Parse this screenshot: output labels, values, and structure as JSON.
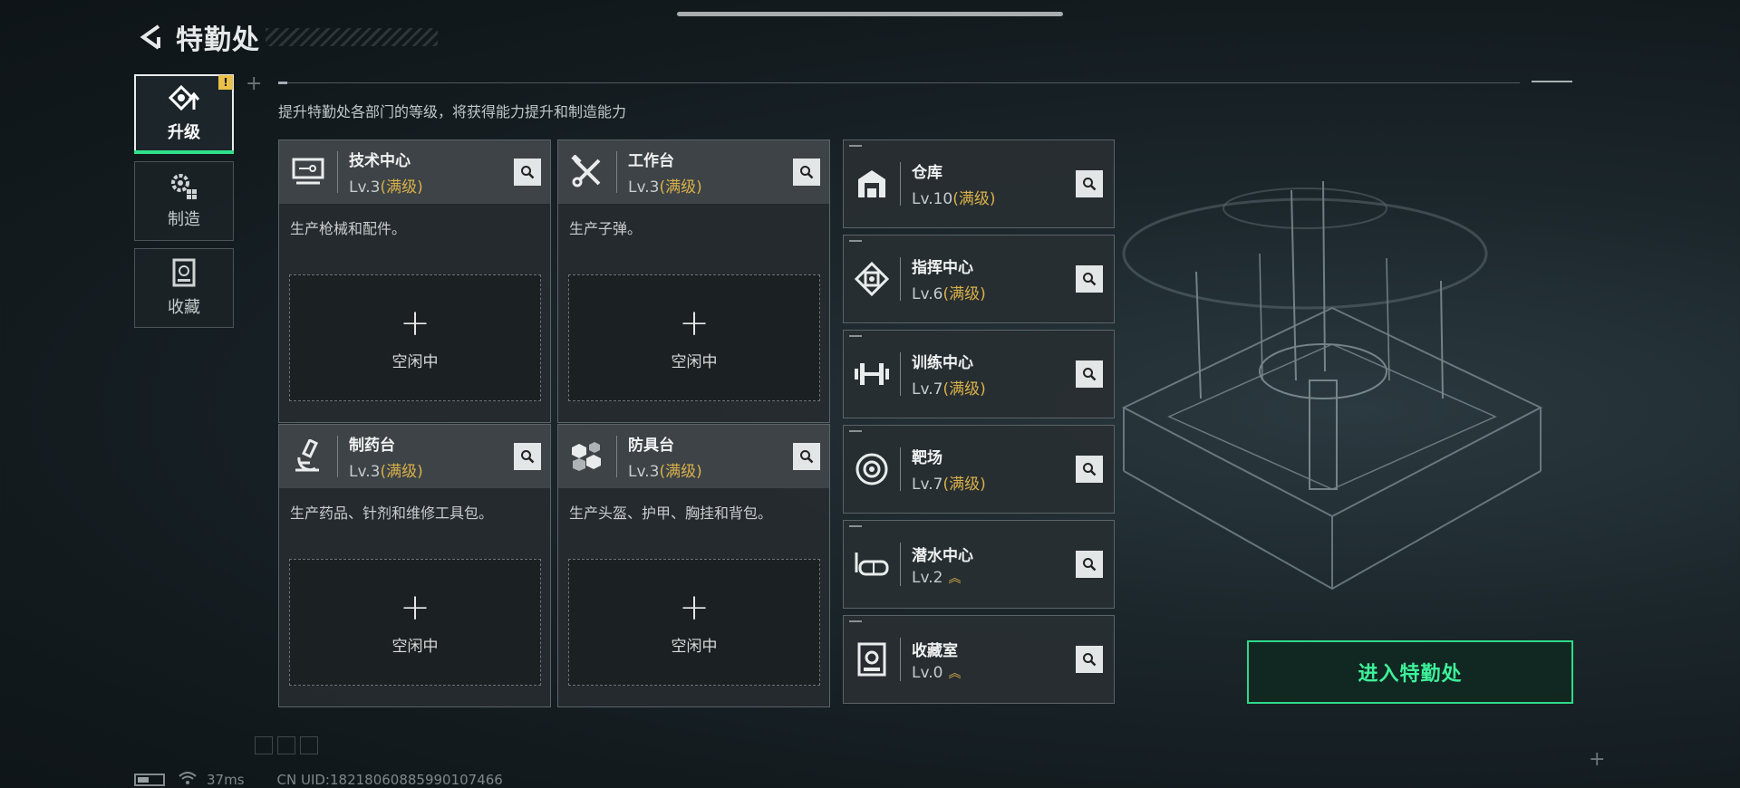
{
  "header": {
    "title": "特勤处"
  },
  "side_tabs": [
    {
      "label": "升级",
      "icon": "upgrade-icon",
      "active": true,
      "alert": "!"
    },
    {
      "label": "制造",
      "icon": "gears-icon",
      "active": false
    },
    {
      "label": "收藏",
      "icon": "collection-icon",
      "active": false
    }
  ],
  "subtitle": "提升特勤处各部门的等级，将获得能力提升和制造能力",
  "workshops": [
    {
      "name": "技术中心",
      "level": "Lv.3",
      "status": "(满级)",
      "desc": "生产枪械和配件。",
      "slot_label": "空闲中",
      "icon": "computer-icon"
    },
    {
      "name": "工作台",
      "level": "Lv.3",
      "status": "(满级)",
      "desc": "生产子弹。",
      "slot_label": "空闲中",
      "icon": "tools-icon"
    },
    {
      "name": "制药台",
      "level": "Lv.3",
      "status": "(满级)",
      "desc": "生产药品、针剂和维修工具包。",
      "slot_label": "空闲中",
      "icon": "microscope-icon"
    },
    {
      "name": "防具台",
      "level": "Lv.3",
      "status": "(满级)",
      "desc": "生产头盔、护甲、胸挂和背包。",
      "slot_label": "空闲中",
      "icon": "armor-blocks-icon"
    }
  ],
  "facilities": [
    {
      "name": "仓库",
      "level": "Lv.10",
      "status": "(满级)",
      "icon": "warehouse-icon"
    },
    {
      "name": "指挥中心",
      "level": "Lv.6",
      "status": "(满级)",
      "icon": "command-chip-icon"
    },
    {
      "name": "训练中心",
      "level": "Lv.7",
      "status": "(满级)",
      "icon": "dumbbell-icon"
    },
    {
      "name": "靶场",
      "level": "Lv.7",
      "status": "(满级)",
      "icon": "target-icon"
    },
    {
      "name": "潜水中心",
      "level": "Lv.2",
      "status": "",
      "icon": "diving-mask-icon",
      "upgradable": true
    },
    {
      "name": "收藏室",
      "level": "Lv.0",
      "status": "",
      "icon": "display-case-icon",
      "upgradable": true
    }
  ],
  "enter_button": {
    "label": "进入特勤处"
  },
  "status_bar": {
    "ping": "37ms",
    "uid": "CN UID:18218060885990107466"
  },
  "colors": {
    "accent_green": "#2fd98a",
    "max_level_gold": "#d9b04a",
    "panel_bg": "#262b2e"
  }
}
